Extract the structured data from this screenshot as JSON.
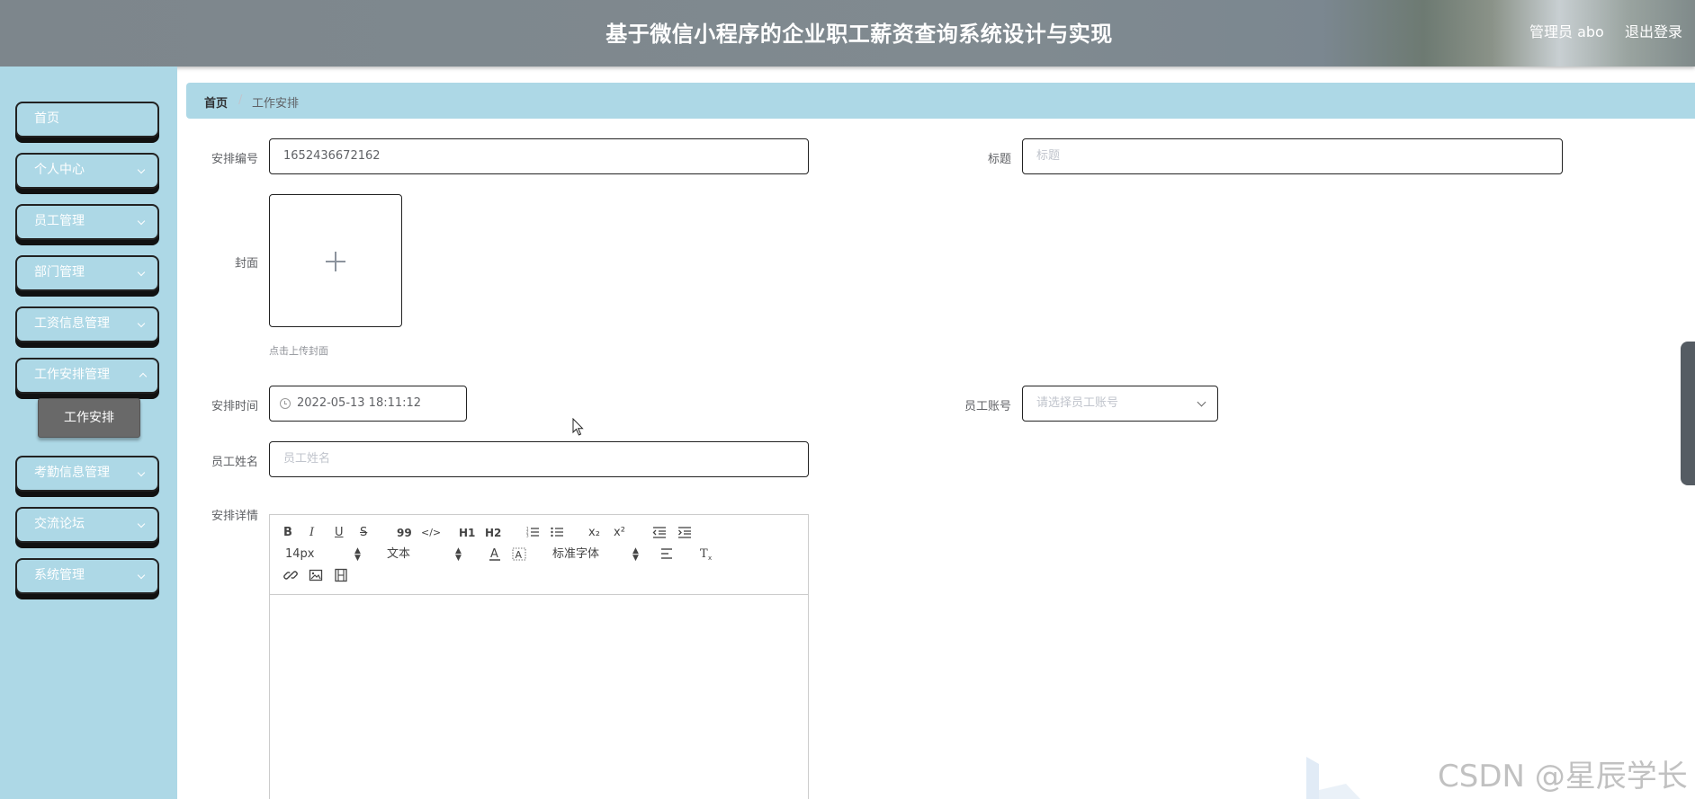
{
  "header": {
    "title": "基于微信小程序的企业职工薪资查询系统设计与实现",
    "user": "管理员 abo",
    "logout": "退出登录"
  },
  "sidebar": {
    "items": [
      {
        "label": "首页"
      },
      {
        "label": "个人中心"
      },
      {
        "label": "员工管理"
      },
      {
        "label": "部门管理"
      },
      {
        "label": "工资信息管理"
      },
      {
        "label": "工作安排管理"
      },
      {
        "label": "考勤信息管理"
      },
      {
        "label": "交流论坛"
      },
      {
        "label": "系统管理"
      }
    ],
    "submenu_active": "工作安排"
  },
  "breadcrumb": {
    "home": "首页",
    "separator": "/",
    "current": "工作安排"
  },
  "form": {
    "code_label": "安排编号",
    "code_value": "1652436672162",
    "title_label": "标题",
    "title_placeholder": "标题",
    "cover_label": "封面",
    "cover_tip": "点击上传封面",
    "time_label": "安排时间",
    "time_value": "2022-05-13 18:11:12",
    "account_label": "员工账号",
    "account_placeholder": "请选择员工账号",
    "name_label": "员工姓名",
    "name_placeholder": "员工姓名",
    "detail_label": "安排详情"
  },
  "editor": {
    "bold": "B",
    "italic": "I",
    "underline": "U",
    "strike": "S",
    "blockquote": "99",
    "code": "</>",
    "h1": "H1",
    "h2": "H2",
    "subscript": "x₂",
    "superscript": "x²",
    "font_size": "14px",
    "format": "文本",
    "font_family": "标准字体"
  },
  "watermark": "CSDN @星辰学长",
  "colors": {
    "sidebar_bg": "#add8e6",
    "header_bg": "#808a90",
    "submenu_active_bg": "#696969"
  }
}
